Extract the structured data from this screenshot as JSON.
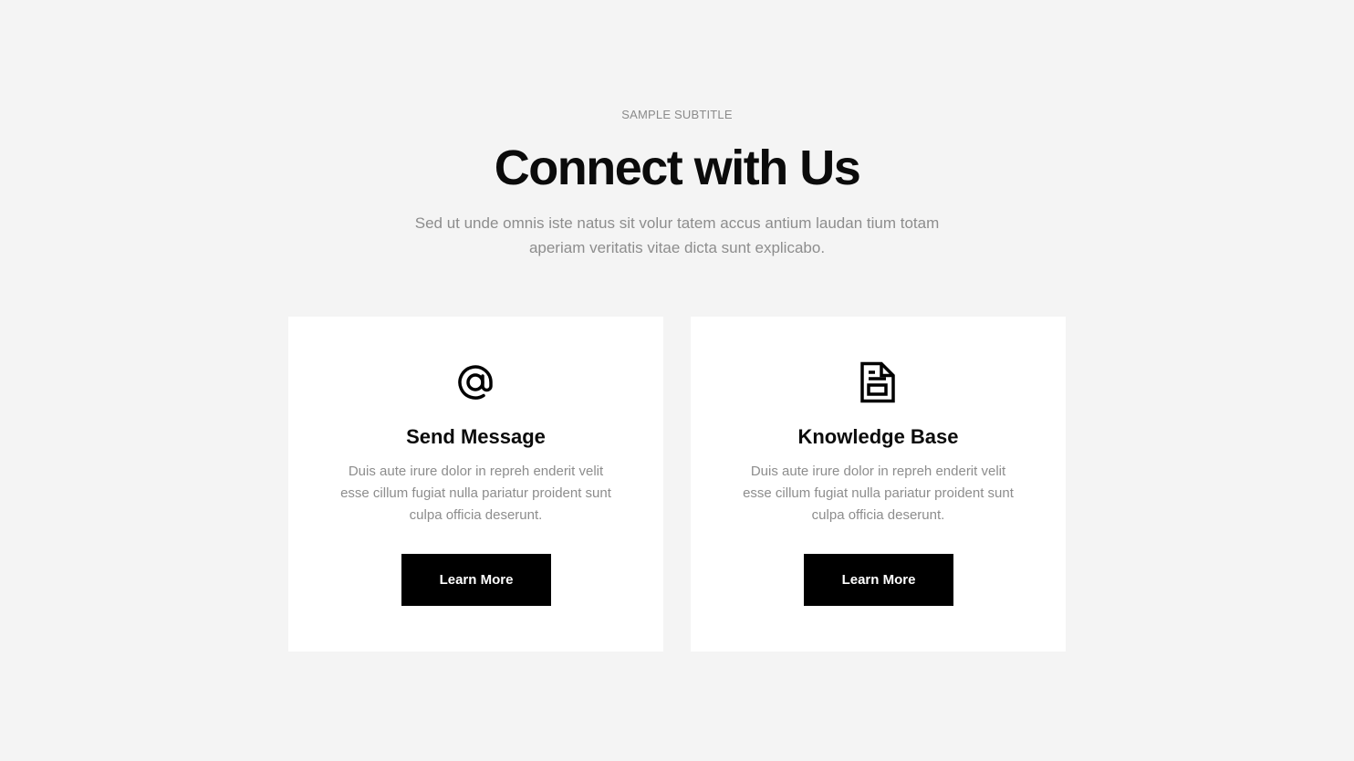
{
  "header": {
    "subtitle": "SAMPLE SUBTITLE",
    "title": "Connect with Us",
    "lead": "Sed ut unde omnis iste natus sit volur tatem accus antium laudan tium totam aperiam veritatis vitae dicta sunt explicabo."
  },
  "cards": [
    {
      "icon": "at-sign-icon",
      "title": "Send Message",
      "text": "Duis aute irure dolor in repreh enderit velit esse cillum fugiat nulla pariatur proident sunt culpa officia deserunt.",
      "button_label": "Learn More"
    },
    {
      "icon": "document-icon",
      "title": "Knowledge Base",
      "text": "Duis aute irure dolor in repreh enderit velit esse cillum fugiat nulla pariatur proident sunt culpa officia deserunt.",
      "button_label": "Learn More"
    }
  ],
  "colors": {
    "background": "#f4f4f4",
    "card": "#ffffff",
    "button": "#000000",
    "button_text": "#ffffff",
    "muted_text": "#8d8d8d",
    "heading": "#0b0b0b"
  }
}
